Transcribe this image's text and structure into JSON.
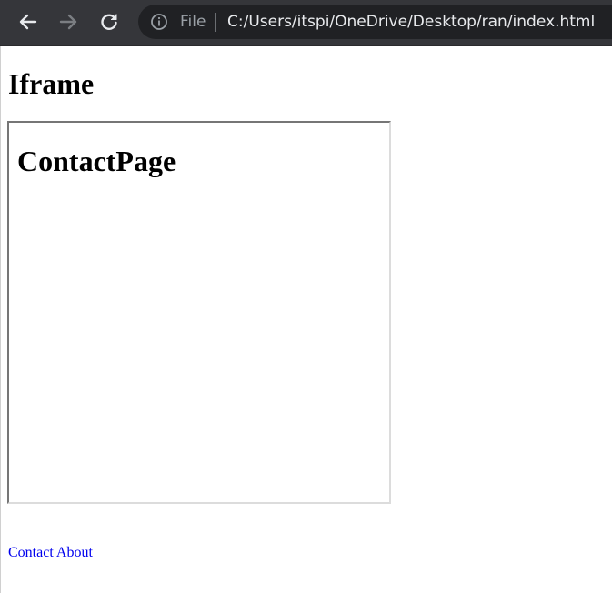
{
  "browser": {
    "scheme_label": "File",
    "url": "C:/Users/itspi/OneDrive/Desktop/ran/index.html"
  },
  "page": {
    "heading": "Iframe",
    "iframe": {
      "heading": "ContactPage"
    },
    "links": [
      {
        "label": "Contact"
      },
      {
        "label": "About"
      }
    ]
  },
  "colors": {
    "toolbar_bg": "#35363a",
    "omnibox_bg": "#202124",
    "link": "#0000ee"
  },
  "icons": [
    "back-arrow-icon",
    "forward-arrow-icon",
    "reload-icon",
    "info-icon"
  ]
}
